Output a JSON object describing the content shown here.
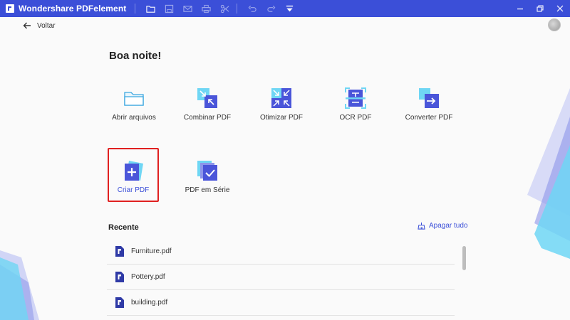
{
  "titlebar": {
    "app_title": "Wondershare PDFelement"
  },
  "nav": {
    "back_label": "Voltar"
  },
  "home": {
    "greeting": "Boa noite!"
  },
  "tools": [
    {
      "label": "Abrir arquivos"
    },
    {
      "label": "Combinar PDF"
    },
    {
      "label": "Otimizar PDF"
    },
    {
      "label": "OCR PDF"
    },
    {
      "label": "Converter PDF"
    },
    {
      "label": "Criar PDF"
    },
    {
      "label": "PDF em Série"
    }
  ],
  "recent": {
    "title": "Recente",
    "clear_label": "Apagar tudo",
    "files": [
      {
        "name": "Furniture.pdf"
      },
      {
        "name": "Pottery.pdf"
      },
      {
        "name": "building.pdf"
      }
    ]
  },
  "colors": {
    "titlebar_bg": "#3b4fd8",
    "accent": "#3b4fd8",
    "selection_border": "#e02020"
  }
}
